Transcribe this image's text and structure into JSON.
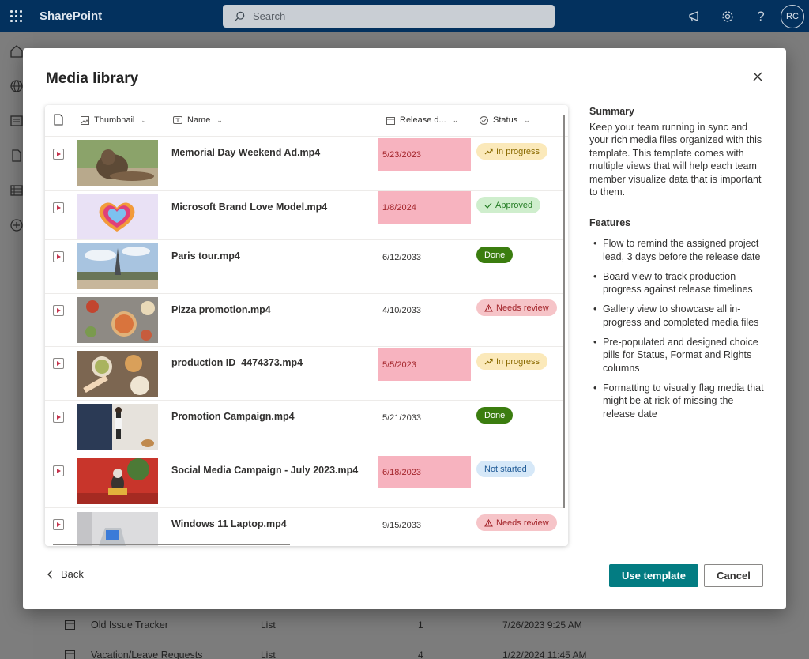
{
  "suitebar": {
    "brand": "SharePoint",
    "search_placeholder": "Search",
    "avatar_initials": "RC"
  },
  "background_list": {
    "rows": [
      {
        "name": "Old Issue Tracker",
        "type": "List",
        "count": "1",
        "modified": "7/26/2023 9:25 AM"
      },
      {
        "name": "Vacation/Leave Requests",
        "type": "List",
        "count": "4",
        "modified": "1/22/2024 11:45 AM"
      }
    ]
  },
  "modal": {
    "title": "Media library",
    "columns": {
      "thumbnail": "Thumbnail",
      "name": "Name",
      "release": "Release d...",
      "status": "Status"
    },
    "rows": [
      {
        "name": "Memorial Day Weekend Ad.mp4",
        "date": "5/23/2023",
        "status": "In progress"
      },
      {
        "name": "Microsoft Brand Love Model.mp4",
        "date": "1/8/2024",
        "status": "Approved"
      },
      {
        "name": "Paris tour.mp4",
        "date": "6/12/2033",
        "status": "Done"
      },
      {
        "name": "Pizza promotion.mp4",
        "date": "4/10/2033",
        "status": "Needs review"
      },
      {
        "name": "production ID_4474373.mp4",
        "date": "5/5/2023",
        "status": "In progress"
      },
      {
        "name": "Promotion Campaign.mp4",
        "date": "5/21/2033",
        "status": "Done"
      },
      {
        "name": "Social Media Campaign - July 2023.mp4",
        "date": "6/18/2023",
        "status": "Not started"
      },
      {
        "name": "Windows 11 Laptop.mp4",
        "date": "9/15/2033",
        "status": "Needs review"
      }
    ],
    "summary": {
      "heading": "Summary",
      "text": "Keep your team running in sync and your rich media files organized with this template. This template comes with multiple views that will help each team member visualize data that is important to them."
    },
    "features": {
      "heading": "Features",
      "items": [
        "Flow to remind the assigned project lead, 3 days before the release date",
        "Board view to track production progress against release timelines",
        "Gallery view to showcase all in-progress and completed media files",
        "Pre-populated and designed choice pills for Status, Format and Rights columns",
        "Formatting to visually flag media that might be at risk of missing the release date"
      ]
    },
    "footer": {
      "back": "Back",
      "use_template": "Use template",
      "cancel": "Cancel"
    }
  },
  "colors": {
    "suitebar": "#03315e",
    "primary_button": "#037c82",
    "date_flag": "#f7b3bf"
  }
}
